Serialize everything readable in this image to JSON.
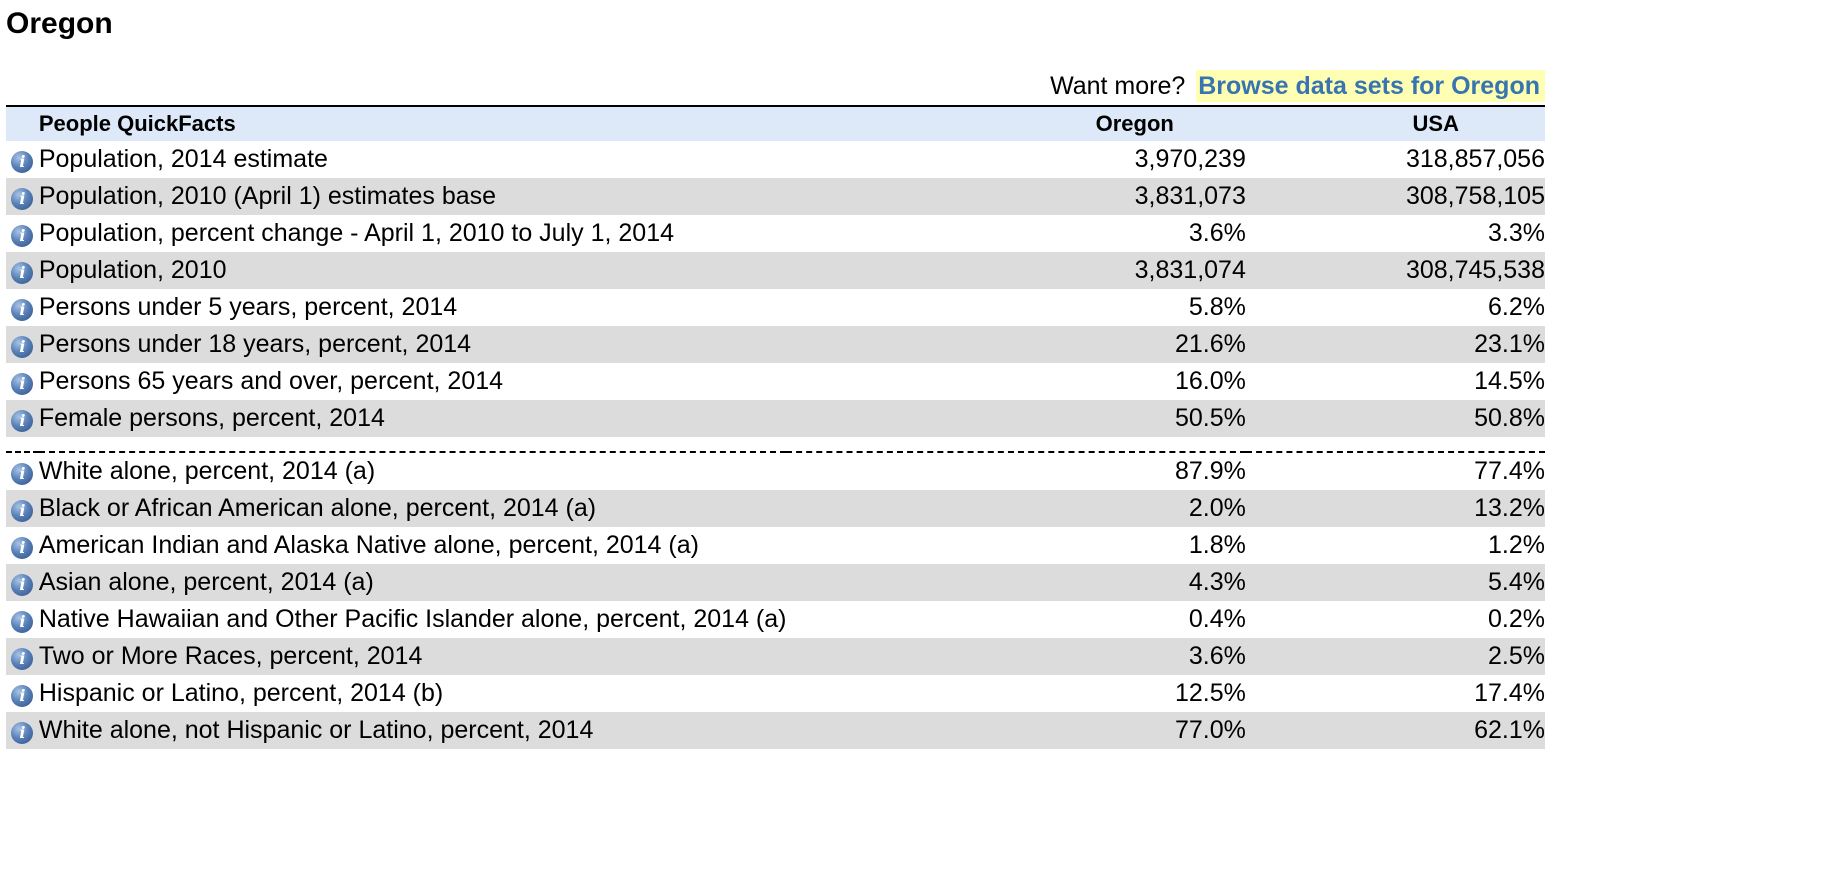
{
  "page": {
    "title": "Oregon"
  },
  "want_more": {
    "prefix": "Want more?",
    "link_label": "Browse data sets for Oregon"
  },
  "table": {
    "headers": {
      "label": "People QuickFacts",
      "oregon": "Oregon",
      "usa": "USA"
    },
    "icon": "info-icon",
    "rows": [
      {
        "label": "Population, 2014 estimate",
        "oregon": "3,970,239",
        "usa": "318,857,056"
      },
      {
        "label": "Population, 2010 (April 1) estimates base",
        "oregon": "3,831,073",
        "usa": "308,758,105"
      },
      {
        "label": "Population, percent change - April 1, 2010 to July 1, 2014",
        "oregon": "3.6%",
        "usa": "3.3%"
      },
      {
        "label": "Population, 2010",
        "oregon": "3,831,074",
        "usa": "308,745,538"
      },
      {
        "label": "Persons under 5 years, percent, 2014",
        "oregon": "5.8%",
        "usa": "6.2%"
      },
      {
        "label": "Persons under 18 years, percent, 2014",
        "oregon": "21.6%",
        "usa": "23.1%"
      },
      {
        "label": "Persons 65 years and over, percent, 2014",
        "oregon": "16.0%",
        "usa": "14.5%"
      },
      {
        "label": "Female persons, percent, 2014",
        "oregon": "50.5%",
        "usa": "50.8%"
      },
      {
        "label": "White alone, percent, 2014 (a)",
        "oregon": "87.9%",
        "usa": "77.4%"
      },
      {
        "label": "Black or African American alone, percent, 2014 (a)",
        "oregon": "2.0%",
        "usa": "13.2%"
      },
      {
        "label": "American Indian and Alaska Native alone, percent, 2014 (a)",
        "oregon": "1.8%",
        "usa": "1.2%"
      },
      {
        "label": "Asian alone, percent, 2014 (a)",
        "oregon": "4.3%",
        "usa": "5.4%"
      },
      {
        "label": "Native Hawaiian and Other Pacific Islander alone, percent, 2014 (a)",
        "oregon": "0.4%",
        "usa": "0.2%"
      },
      {
        "label": "Two or More Races, percent, 2014",
        "oregon": "3.6%",
        "usa": "2.5%"
      },
      {
        "label": "Hispanic or Latino, percent, 2014 (b)",
        "oregon": "12.5%",
        "usa": "17.4%"
      },
      {
        "label": "White alone, not Hispanic or Latino, percent, 2014",
        "oregon": "77.0%",
        "usa": "62.1%"
      }
    ]
  },
  "colors": {
    "header_bg": "#dde9f8",
    "shaded_row_bg": "#dcdcdc",
    "link_color": "#3774b0",
    "link_highlight": "#ffffb4"
  }
}
